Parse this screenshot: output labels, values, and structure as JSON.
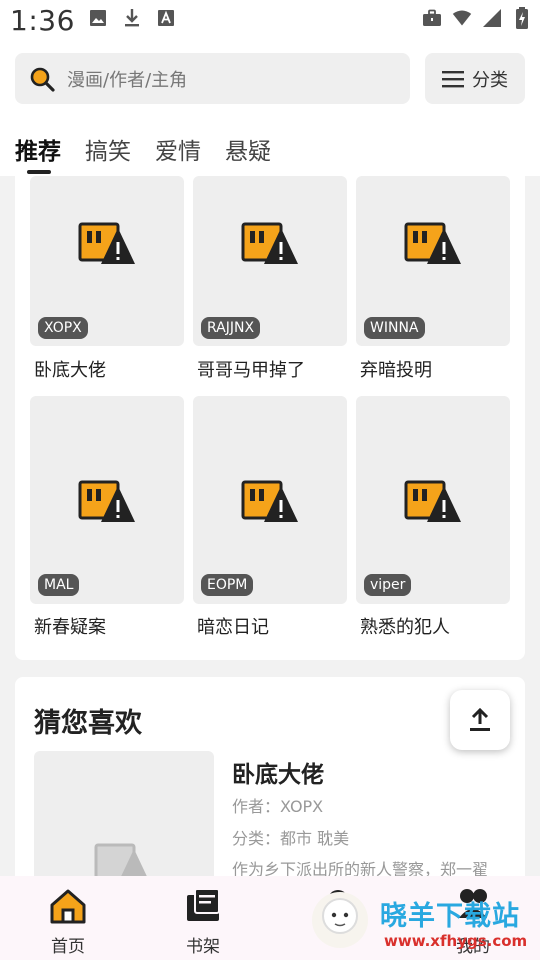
{
  "status": {
    "time": "1:36"
  },
  "search": {
    "placeholder": "漫画/作者/主角"
  },
  "category_button": {
    "label": "分类"
  },
  "tabs": [
    {
      "label": "推荐",
      "active": true
    },
    {
      "label": "搞笑"
    },
    {
      "label": "爱情"
    },
    {
      "label": "悬疑"
    }
  ],
  "grid": [
    {
      "badge": "XOPX",
      "title": "卧底大佬"
    },
    {
      "badge": "RAJJNX",
      "title": "哥哥马甲掉了"
    },
    {
      "badge": "WINNA",
      "title": "弃暗投明"
    },
    {
      "badge": "MAL",
      "title": "新春疑案"
    },
    {
      "badge": "EOPM",
      "title": "暗恋日记"
    },
    {
      "badge": "viper",
      "title": "熟悉的犯人"
    }
  ],
  "guess": {
    "heading": "猜您喜欢",
    "title": "卧底大佬",
    "author": "作者：XOPX",
    "category": "分类：都市 耽美",
    "summary": "作为乡下派出所的新人警察，郑一翟"
  },
  "nav": [
    {
      "label": "首页",
      "icon": "home-icon"
    },
    {
      "label": "书架",
      "icon": "bookshelf-icon"
    },
    {
      "label": "",
      "icon": "explore-icon"
    },
    {
      "label": "我的",
      "icon": "profile-icon"
    }
  ],
  "watermark": {
    "brand": "晓羊下载站",
    "url": "www.xfhygs.com"
  },
  "colors": {
    "accent": "#f5a31a",
    "badge": "#555555",
    "bottom_nav_bg": "#fdf6fa"
  }
}
